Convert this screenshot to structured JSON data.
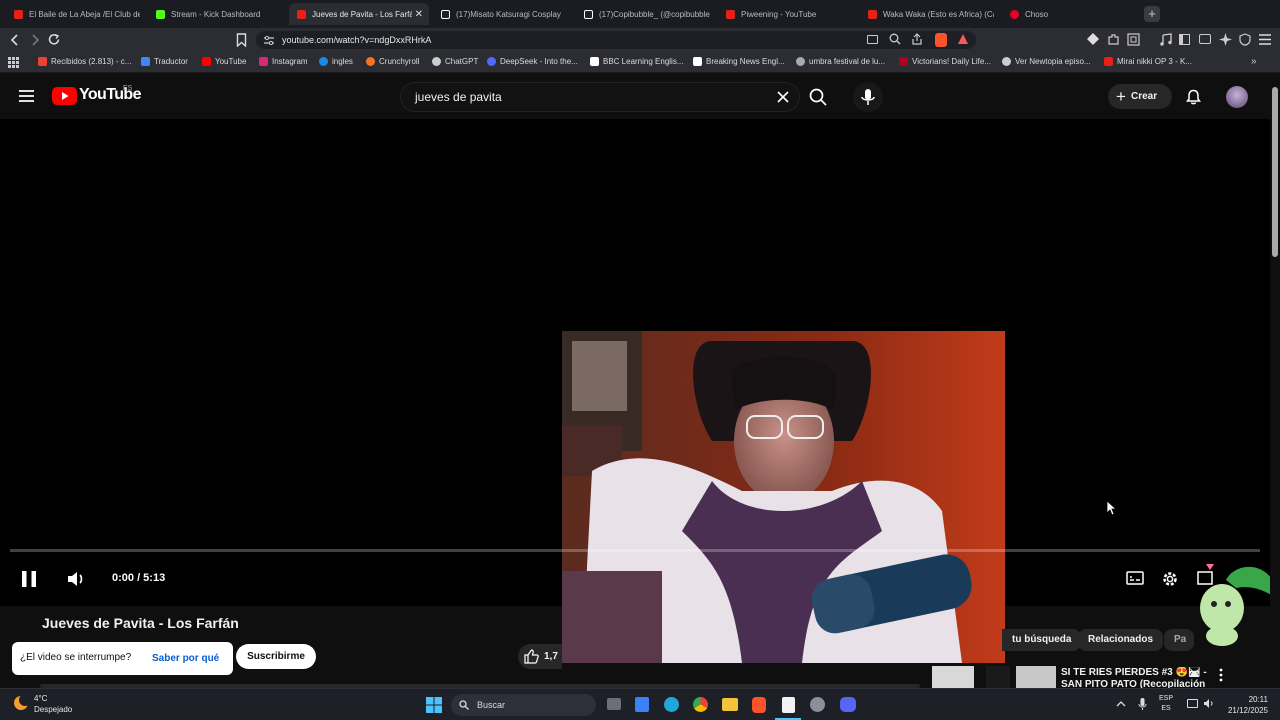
{
  "tabs": [
    {
      "label": "El Baile de La Abeja /El Club de",
      "color": "#e62117"
    },
    {
      "label": "Stream - Kick Dashboard",
      "color": "#53fc18"
    },
    {
      "label": "Jueves de Pavita - Los Farfá",
      "color": "#e62117",
      "active": true
    },
    {
      "label": "(17)Misato Katsuragi Cosplay",
      "color": "#ffffff"
    },
    {
      "label": "(17)Copibubble_ (@copibubble",
      "color": "#ffffff"
    },
    {
      "label": "Piweening - YouTube",
      "color": "#e62117"
    },
    {
      "label": "Waka Waka (Esto es Africa) (Ca",
      "color": "#e62117"
    },
    {
      "label": "Choso",
      "color": "#e60023"
    }
  ],
  "address": {
    "url": "youtube.com/watch?v=ndgDxxRHrkA"
  },
  "bookmarks": [
    {
      "label": "Recibidos (2.813) - c...",
      "color": "#ea4335"
    },
    {
      "label": "Traductor",
      "color": "#4285f4"
    },
    {
      "label": "YouTube",
      "color": "#ff0000"
    },
    {
      "label": "Instagram",
      "color": "#d62976"
    },
    {
      "label": "ingles",
      "color": "#1e88e5"
    },
    {
      "label": "Crunchyroll",
      "color": "#f47521"
    },
    {
      "label": "ChatGPT",
      "color": "#cccccc"
    },
    {
      "label": "DeepSeek - Into the...",
      "color": "#4d6bfe"
    },
    {
      "label": "BBC Learning Englis...",
      "color": "#ffffff"
    },
    {
      "label": "Breaking News Engl...",
      "color": "#ffffff"
    },
    {
      "label": "umbra festival de lu...",
      "color": "#aaaaaa"
    },
    {
      "label": "Victorians! Daily Life...",
      "color": "#b00020"
    },
    {
      "label": "Ver Newtopia episo...",
      "color": "#cccccc"
    },
    {
      "label": "Mirai nikki OP 3 - K...",
      "color": "#e62117"
    }
  ],
  "youtube": {
    "logo_text": "YouTube",
    "region": "ES",
    "search_value": "jueves de pavita",
    "create_label": "Crear"
  },
  "player": {
    "time": "0:00 / 5:13",
    "progress": 0
  },
  "video": {
    "title": "Jueves de Pavita - Los Farfán",
    "likes": "1,7",
    "tip_question": "¿El video se interrumpe?",
    "tip_link": "Saber por qué",
    "subscribe_label": "Suscribirme"
  },
  "chips": [
    "tu búsqueda",
    "Relacionados",
    "Pa"
  ],
  "related": {
    "title_line1": "SI TE RIES PIERDES #3 😍🛤 -",
    "title_line2": "SAN PITO PATO (Recopilación"
  },
  "taskbar": {
    "weather_temp": "4°C",
    "weather_desc": "Despejado",
    "search_label": "Buscar",
    "lang1": "ESP",
    "lang2": "ES",
    "time": "20:11",
    "date": "21/12/2025"
  },
  "colors": {
    "yt_red": "#ff0000",
    "bg": "#0f0f0f"
  }
}
